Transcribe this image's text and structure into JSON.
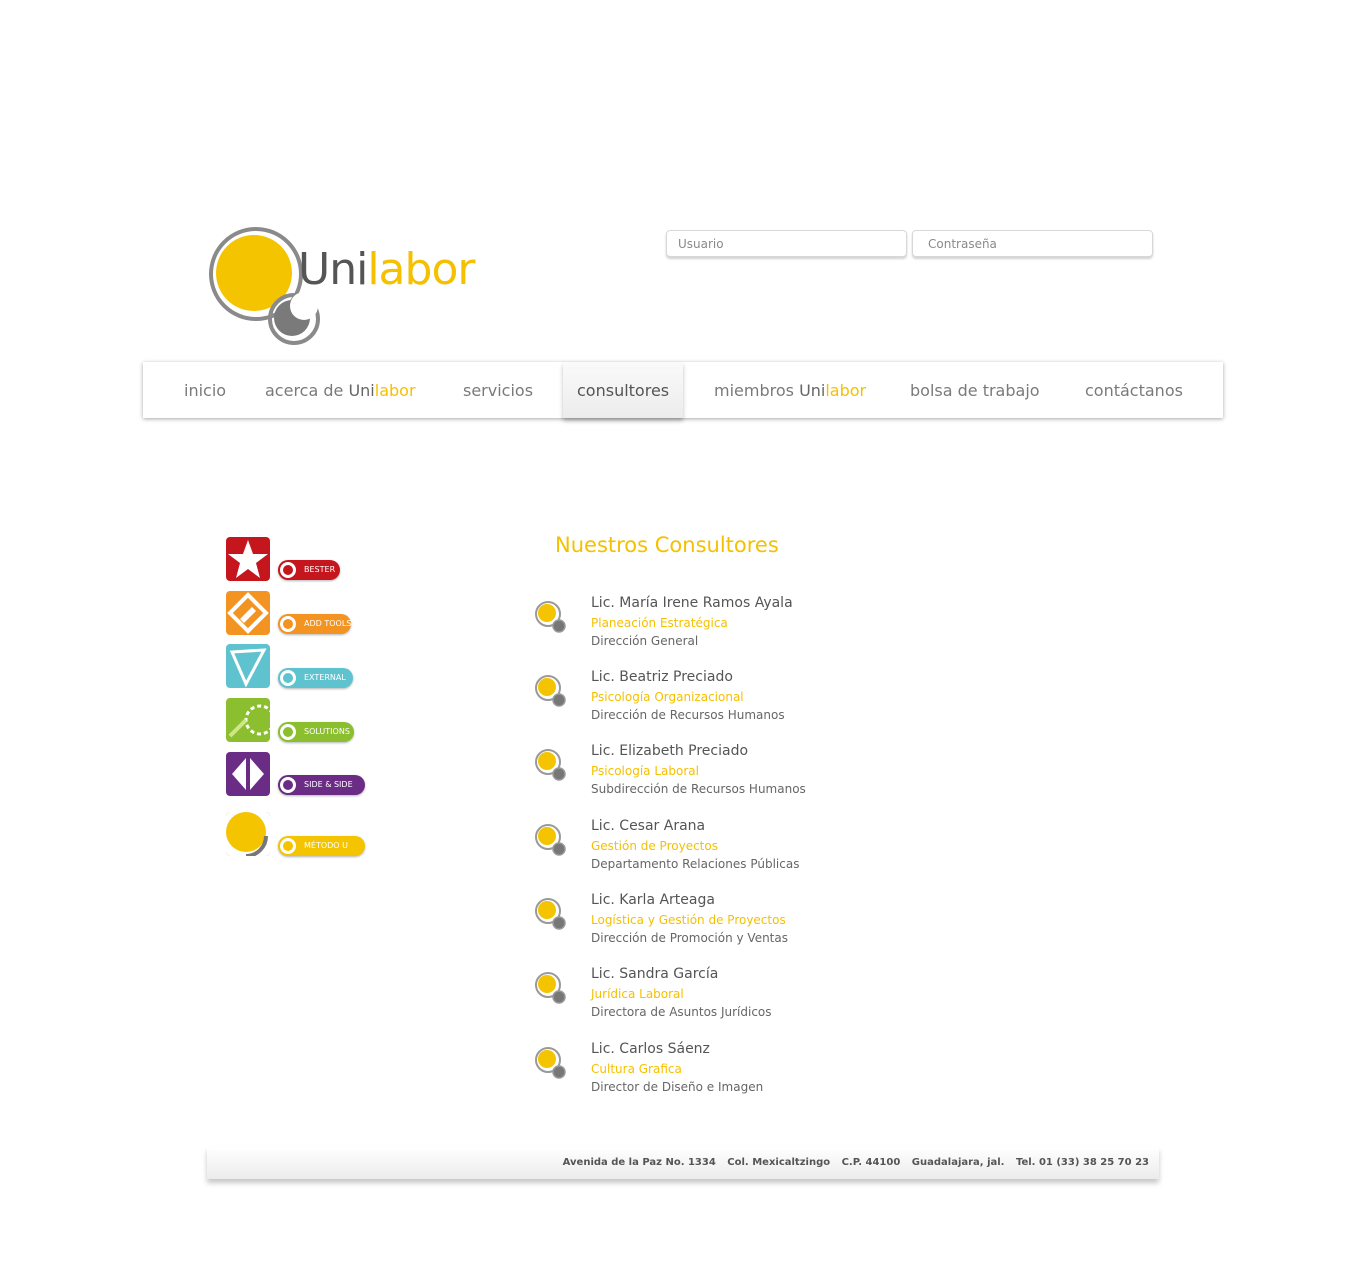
{
  "logo": {
    "part1": "Uni",
    "part2": "labor",
    "colors": {
      "accent": "#f5c000",
      "grey": "#555555"
    }
  },
  "login": {
    "user_placeholder": "Usuario",
    "pass_placeholder": "Contraseña"
  },
  "nav": {
    "inicio": "inicio",
    "acerca_prefix": "acerca de ",
    "acerca_uni": "Uni",
    "acerca_labor": "labor",
    "servicios": "servicios",
    "consultores": "consultores",
    "miembros_prefix": "miembros ",
    "miembros_uni": "Uni",
    "miembros_labor": "labor",
    "bolsa": "bolsa de trabajo",
    "contacto": "contáctanos",
    "active": "consultores"
  },
  "brands": [
    {
      "label": "BESTER",
      "color": "#c4161c",
      "icon": "star-icon"
    },
    {
      "label": "ADD TOOLS",
      "color": "#f39321",
      "icon": "pencil-icon"
    },
    {
      "label": "EXTERNAL",
      "color": "#5ec3cf",
      "icon": "external-icon"
    },
    {
      "label": "SOLUTIONS",
      "color": "#8cbf2f",
      "icon": "gear-icon"
    },
    {
      "label": "SIDE & SIDE",
      "color": "#6b2c86",
      "icon": "arrows-icon"
    },
    {
      "label": "MÉTODO U",
      "color": "#f5c400",
      "icon": "circle-icon"
    }
  ],
  "consultants": {
    "title": "Nuestros Consultores",
    "items": [
      {
        "name": "Lic. María Irene Ramos Ayala",
        "area": "Planeación Estratégica",
        "role": "Dirección General"
      },
      {
        "name": "Lic. Beatriz Preciado",
        "area": "Psicología Organizacional",
        "role": "Dirección de Recursos Humanos"
      },
      {
        "name": "Lic. Elizabeth Preciado",
        "area": "Psicología Laboral",
        "role": "Subdirección de Recursos Humanos"
      },
      {
        "name": "Lic. Cesar Arana",
        "area": "Gestión de Proyectos",
        "role": "Departamento Relaciones Públicas"
      },
      {
        "name": "Lic. Karla Arteaga",
        "area": "Logística y Gestión de Proyectos",
        "role": "Dirección de Promoción y Ventas"
      },
      {
        "name": "Lic. Sandra García",
        "area": "Jurídica Laboral",
        "role": "Directora de Asuntos Jurídicos"
      },
      {
        "name": "Lic. Carlos Sáenz",
        "area": "Cultura Grafica",
        "role": "Director de Diseño e Imagen"
      }
    ]
  },
  "footer": {
    "address": "Avenida de la Paz No. 1334",
    "colonia": "Col. Mexicaltzingo",
    "cp": "C.P. 44100",
    "city": "Guadalajara, jal.",
    "tel": "Tel. 01 (33) 38 25 70 23"
  }
}
